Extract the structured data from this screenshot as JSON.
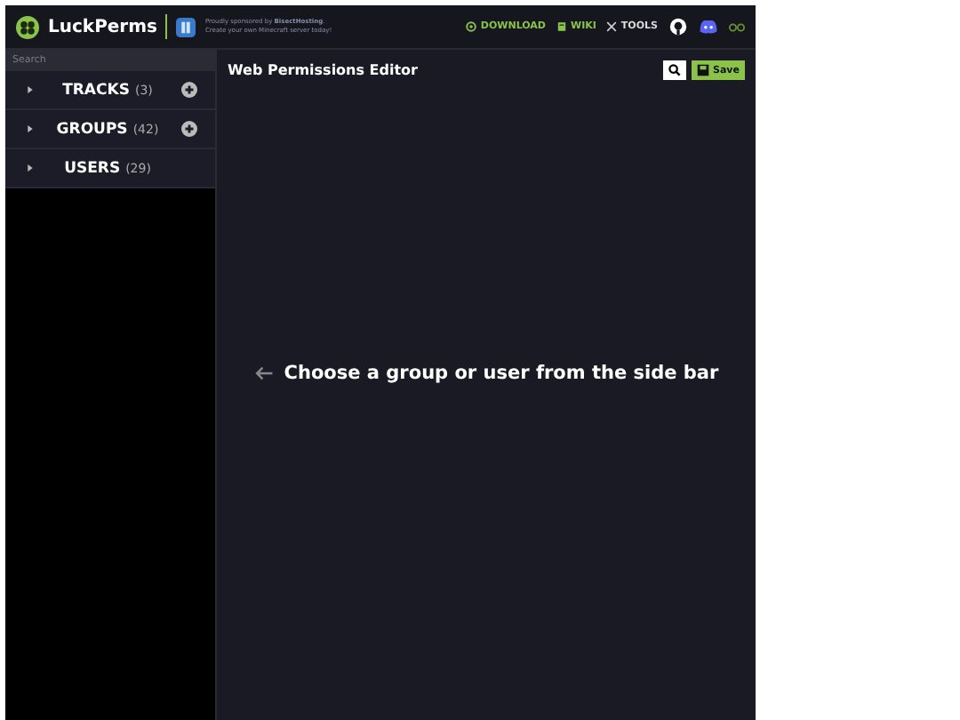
{
  "header": {
    "brand": "LuckPerms",
    "sponsor_line_1": "Proudly sponsored by **BisectHosting**.",
    "sponsor_line_2": "Create your own Minecraft server today!",
    "nav": [
      {
        "kind": "download",
        "label": "DOWNLOAD"
      },
      {
        "kind": "wiki",
        "label": "WIKI"
      },
      {
        "kind": "tools",
        "label": "TOOLS"
      },
      {
        "kind": "github"
      },
      {
        "kind": "discord"
      },
      {
        "kind": "toggle"
      }
    ]
  },
  "sidebar": {
    "search": {
      "placeholder": "Search"
    },
    "sections": [
      {
        "label": "TRACKS",
        "count": "(3)",
        "addable": true,
        "expanded": false
      },
      {
        "label": "GROUPS",
        "count": "(42)",
        "addable": true,
        "expanded": false
      },
      {
        "label": "USERS",
        "count": "(29)",
        "addable": false,
        "expanded": false
      }
    ]
  },
  "editor": {
    "title": "Web Permissions Editor",
    "save_label": "Save",
    "message": "Choose a group or user from the side bar"
  }
}
